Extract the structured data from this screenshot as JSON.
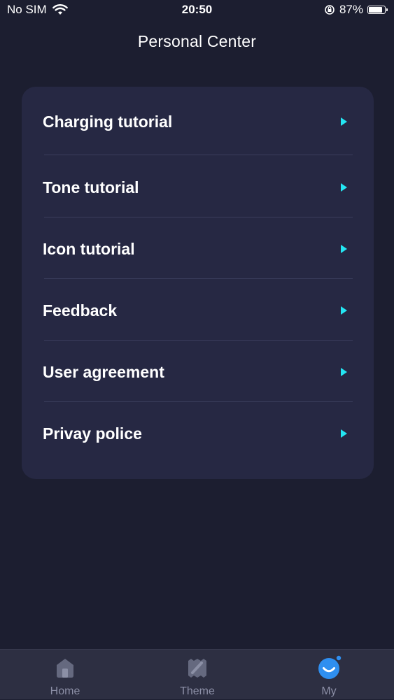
{
  "status_bar": {
    "carrier": "No SIM",
    "time": "20:50",
    "battery_percent": "87%",
    "battery_level": 0.87
  },
  "header": {
    "title": "Personal Center"
  },
  "menu": {
    "items": [
      {
        "label": "Charging tutorial"
      },
      {
        "label": "Tone tutorial"
      },
      {
        "label": "Icon tutorial"
      },
      {
        "label": "Feedback"
      },
      {
        "label": "User agreement"
      },
      {
        "label": "Privay police"
      }
    ]
  },
  "tab_bar": {
    "tabs": [
      {
        "label": "Home",
        "icon": "home-icon"
      },
      {
        "label": "Theme",
        "icon": "theme-icon"
      },
      {
        "label": "My",
        "icon": "my-icon"
      }
    ],
    "active": "My"
  },
  "colors": {
    "background": "#1c1e30",
    "card": "#262843",
    "accent": "#24e6f3",
    "tab_active": "#2f8ff0",
    "tab_inactive": "#8c8fa6"
  }
}
